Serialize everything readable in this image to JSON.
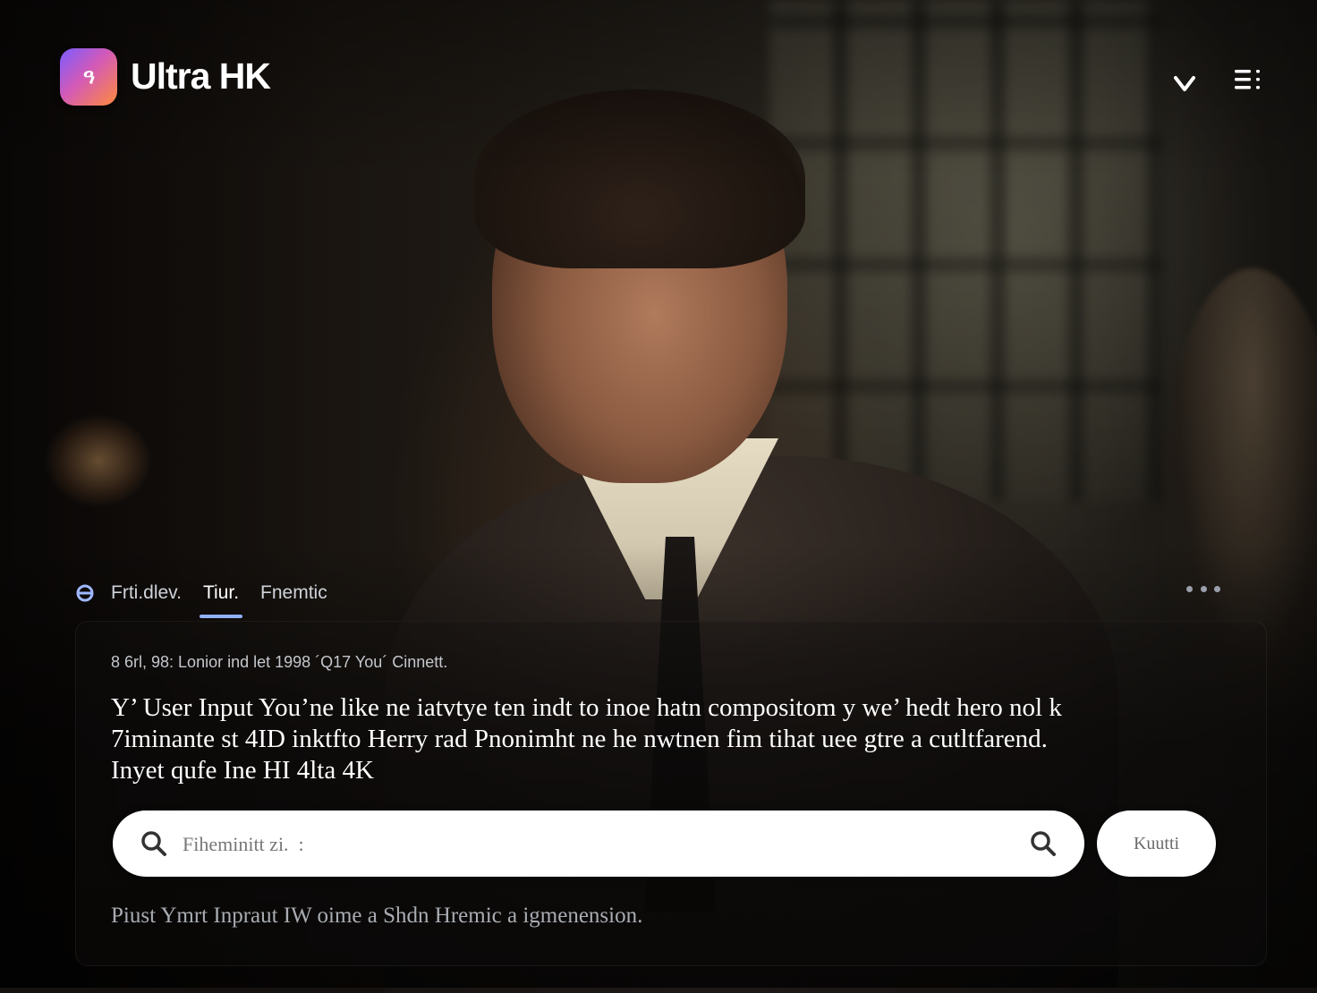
{
  "app": {
    "logo_text": "ዓ",
    "brand": "Ultra HK"
  },
  "header": {
    "chevron_icon": "chevron-down-icon",
    "menu_icon": "menu-icon"
  },
  "tabs": {
    "icon": "filter-icon",
    "items": [
      {
        "label": "Frti.dlev.",
        "active": false
      },
      {
        "label": "Tiur.",
        "active": true
      },
      {
        "label": "Fnemtic",
        "active": false
      }
    ],
    "more_icon": "more-horizontal-icon"
  },
  "panel": {
    "meta": "8 6rl, 98: Lonior ind let 1998 ´Q17 You´ Cinnett.",
    "description_lines": [
      "Y’ User Input You’ne like ne iatvtye ten indt to inoe hatn compositom y we’ hedt hero nol k",
      "7iminante st 4ID  inktfto Herry rad Pnonimht ne he nwtnen fim tihat uee gtre a cutltfarend.",
      "Inyet qufe Ine HI 4lta 4K"
    ],
    "search": {
      "left_icon": "search-icon",
      "right_icon": "search-icon",
      "placeholder": "Fiheminitt zi.  :",
      "value": ""
    },
    "action_button": "Kuutti",
    "footnote": "Piust Ymrt Inpraut IW oime a Shdn Hremic a igmenension."
  },
  "colors": {
    "accent": "#8fb2ff",
    "logo_gradient_start": "#7b5cff",
    "logo_gradient_end": "#ff8a3d"
  }
}
